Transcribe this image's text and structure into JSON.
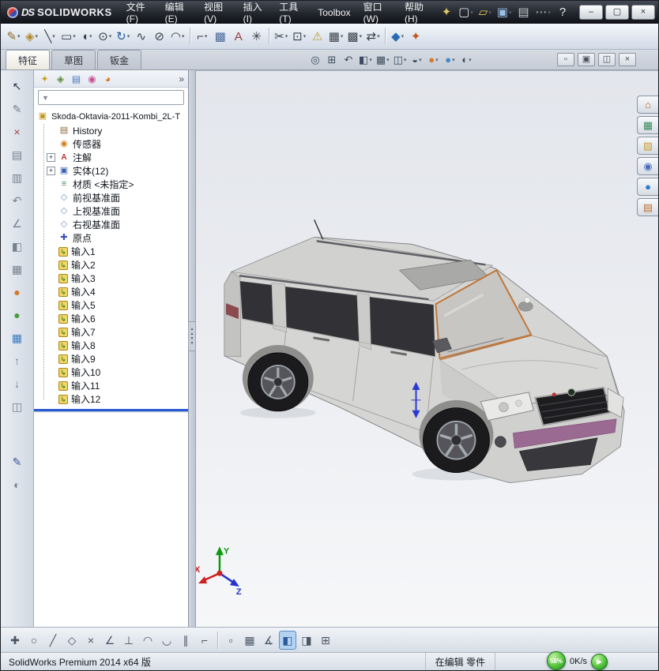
{
  "app": {
    "logo_mark": "DS",
    "logo_text": "SOLIDWORKS",
    "menus": [
      "文件(F)",
      "编辑(E)",
      "视图(V)",
      "插入(I)",
      "工具(T)",
      "Toolbox",
      "窗口(W)",
      "帮助(H)"
    ]
  },
  "tabs": [
    {
      "label": "特征",
      "active": true
    },
    {
      "label": "草图",
      "active": false
    },
    {
      "label": "钣金",
      "active": false
    }
  ],
  "tree_panel": {
    "overflow": "»",
    "filter_glyph": "▼"
  },
  "feature_tree": {
    "root_label": "Skoda-Oktavia-2011-Kombi_2L-T",
    "icon_glyphs": {
      "part": "▣",
      "history": "▤",
      "sensor": "◉",
      "annotation": "A",
      "bodies": "▣",
      "material": "≡",
      "plane": "◇",
      "origin": "✚",
      "imported": "↳"
    },
    "items": [
      {
        "label": "History",
        "icon": "history"
      },
      {
        "label": "传感器",
        "icon": "sensor"
      },
      {
        "label": "注解",
        "icon": "annotation",
        "expander": true
      },
      {
        "label": "实体(12)",
        "icon": "bodies",
        "expander": true
      },
      {
        "label": "材质 <未指定>",
        "icon": "material"
      },
      {
        "label": "前视基准面",
        "icon": "plane"
      },
      {
        "label": "上视基准面",
        "icon": "plane"
      },
      {
        "label": "右视基准面",
        "icon": "plane"
      },
      {
        "label": "原点",
        "icon": "origin"
      },
      {
        "label": "输入1",
        "icon": "imported"
      },
      {
        "label": "输入2",
        "icon": "imported"
      },
      {
        "label": "输入3",
        "icon": "imported"
      },
      {
        "label": "输入4",
        "icon": "imported"
      },
      {
        "label": "输入5",
        "icon": "imported"
      },
      {
        "label": "输入6",
        "icon": "imported"
      },
      {
        "label": "输入7",
        "icon": "imported"
      },
      {
        "label": "输入8",
        "icon": "imported"
      },
      {
        "label": "输入9",
        "icon": "imported"
      },
      {
        "label": "输入10",
        "icon": "imported"
      },
      {
        "label": "输入11",
        "icon": "imported"
      },
      {
        "label": "输入12",
        "icon": "imported"
      }
    ]
  },
  "viewport": {
    "triad": {
      "x": "X",
      "y": "Y",
      "z": "Z"
    }
  },
  "statusbar": {
    "product": "SolidWorks Premium 2014 x64 版",
    "mode": "在编辑 零件",
    "gauge_percent": "58%",
    "net_speed": "0K/s",
    "boost_glyph": "▶"
  },
  "icon_groups": {
    "titlebar_quick": [
      {
        "name": "menu-pin-icon",
        "glyph": "✦",
        "color": "#e0c860"
      },
      {
        "name": "new-document-icon",
        "glyph": "▢",
        "color": "#e6ebf2",
        "caret": true
      },
      {
        "name": "open-document-icon",
        "glyph": "▱",
        "color": "#e8c85a",
        "caret": true
      },
      {
        "name": "save-icon",
        "glyph": "▣",
        "color": "#9ac0e8",
        "caret": true
      },
      {
        "name": "print-icon",
        "glyph": "▤",
        "color": "#c6ccd6"
      },
      {
        "name": "options-icon",
        "glyph": "⋯",
        "color": "#c6ccd6",
        "caret": true
      },
      {
        "name": "help-icon",
        "glyph": "?",
        "color": "#e6ebf2"
      }
    ],
    "window_controls": [
      {
        "name": "minimize-button",
        "glyph": "–"
      },
      {
        "name": "maximize-button",
        "glyph": "▢"
      },
      {
        "name": "close-button",
        "glyph": "×"
      }
    ],
    "toolbar_main": [
      {
        "name": "sketch-icon",
        "glyph": "✎",
        "color": "#8a6a2a",
        "caret": true
      },
      {
        "name": "smart-dimension-icon",
        "glyph": "◈",
        "color": "#b08828",
        "caret": true
      },
      {
        "name": "line-icon",
        "glyph": "╲",
        "color": "#384048",
        "caret": true
      },
      {
        "name": "corner-rectangle-icon",
        "glyph": "▭",
        "color": "#384048",
        "caret": true
      },
      {
        "name": "straight-slot-icon",
        "glyph": "◖",
        "color": "#384048",
        "caret": true
      },
      {
        "name": "circle-icon",
        "glyph": "⊙",
        "color": "#384048",
        "caret": true
      },
      {
        "name": "spiral-icon",
        "glyph": "↻",
        "color": "#2a5a9a",
        "caret": true
      },
      {
        "name": "spline-icon",
        "glyph": "∿",
        "color": "#384048"
      },
      {
        "name": "ellipse-icon",
        "glyph": "⊘",
        "color": "#384048"
      },
      {
        "name": "arc-icon",
        "glyph": "◠",
        "color": "#384048",
        "caret": true
      },
      {
        "sep": true
      },
      {
        "name": "sketch-fillet-icon",
        "glyph": "⌐",
        "color": "#384048",
        "caret": true
      },
      {
        "name": "convert-entities-icon",
        "glyph": "▩",
        "color": "#4a6a9a"
      },
      {
        "name": "text-icon",
        "glyph": "A",
        "color": "#9a3a3a"
      },
      {
        "name": "point-icon",
        "glyph": "✳",
        "color": "#384048"
      },
      {
        "sep": true
      },
      {
        "name": "trim-entities-icon",
        "glyph": "✂",
        "color": "#384048",
        "caret": true
      },
      {
        "name": "offset-entities-icon",
        "glyph": "⊡",
        "color": "#384048",
        "caret": true
      },
      {
        "name": "warning-icon",
        "glyph": "⚠",
        "color": "#c8a020"
      },
      {
        "name": "linear-pattern-icon",
        "glyph": "▦",
        "color": "#384048",
        "caret": true
      },
      {
        "name": "display-grid-icon",
        "glyph": "▩",
        "color": "#384048",
        "caret": true
      },
      {
        "name": "move-entities-icon",
        "glyph": "⇄",
        "color": "#384048",
        "caret": true
      },
      {
        "sep": true
      },
      {
        "name": "quick-snaps-icon",
        "glyph": "◆",
        "color": "#2a6ab0",
        "caret": true
      },
      {
        "name": "rapid-sketch-icon",
        "glyph": "✦",
        "color": "#c05820"
      }
    ],
    "viewport_toolbar": [
      {
        "name": "zoom-to-fit-icon",
        "glyph": "◎",
        "color": "#3a4a5c"
      },
      {
        "name": "zoom-to-area-icon",
        "glyph": "⊞",
        "color": "#3a4a5c"
      },
      {
        "name": "previous-view-icon",
        "glyph": "↶",
        "color": "#3a4a5c"
      },
      {
        "name": "section-view-icon",
        "glyph": "◧",
        "color": "#3a4a5c",
        "caret": true
      },
      {
        "name": "view-orientation-icon",
        "glyph": "▦",
        "color": "#3a4a5c",
        "caret": true
      },
      {
        "name": "display-style-icon",
        "glyph": "◫",
        "color": "#3a4a5c",
        "caret": true
      },
      {
        "name": "hide-show-items-icon",
        "glyph": "◒",
        "color": "#3a4a5c",
        "caret": true
      },
      {
        "name": "edit-app­earance-icon",
        "glyph": "●",
        "color": "#d4782a",
        "caret": true
      },
      {
        "name": "apply-scene-icon",
        "glyph": "●",
        "color": "#3a8ad0",
        "caret": true
      },
      {
        "name": "view-settings-icon",
        "glyph": "◐",
        "color": "#3a4a5c",
        "caret": true
      }
    ],
    "doc_window_buttons": [
      {
        "name": "doc-minimize-icon",
        "glyph": "▫"
      },
      {
        "name": "doc-restore-icon",
        "glyph": "▣"
      },
      {
        "name": "doc-tile-icon",
        "glyph": "◫"
      },
      {
        "name": "doc-close-icon",
        "glyph": "×"
      }
    ],
    "left_strip": [
      {
        "name": "select-cursor-icon",
        "glyph": "↖",
        "color": "#2a3240"
      },
      {
        "name": "sketch-edit-icon",
        "glyph": "✎",
        "color": "#77808e"
      },
      {
        "name": "delete-icon",
        "glyph": "×",
        "color": "#a04848"
      },
      {
        "name": "copy-icon",
        "glyph": "▤",
        "color": "#77808e"
      },
      {
        "name": "paste-icon",
        "glyph": "▥",
        "color": "#77808e"
      },
      {
        "name": "undo-icon",
        "glyph": "↶",
        "color": "#77808e"
      },
      {
        "name": "measure-icon",
        "glyph": "∠",
        "color": "#77808e"
      },
      {
        "name": "section-tool-icon",
        "glyph": "◧",
        "color": "#77808e"
      },
      {
        "name": "view-cube-icon",
        "glyph": "▦",
        "color": "#77808e"
      },
      {
        "name": "appearance-ball-icon",
        "glyph": "●",
        "color": "#d4782a"
      },
      {
        "name": "material-ball-icon",
        "glyph": "●",
        "color": "#4a9a40"
      },
      {
        "name": "texture-grid-icon",
        "glyph": "▦",
        "color": "#3a7ac2"
      },
      {
        "name": "feature-order-up-icon",
        "glyph": "↑",
        "color": "#77808e"
      },
      {
        "name": "feature-order-down-icon",
        "glyph": "↓",
        "color": "#77808e"
      },
      {
        "name": "display-states-icon",
        "glyph": "◫",
        "color": "#77808e"
      },
      {
        "gap": 36
      },
      {
        "name": "paint-tool-icon",
        "glyph": "✎",
        "color": "#3a5a9a"
      },
      {
        "name": "eyedropper-icon",
        "glyph": "◐",
        "color": "#77808e"
      }
    ],
    "tree_toolbar": [
      {
        "name": "featuremanager-tab-icon",
        "glyph": "✦",
        "color": "#c8a020"
      },
      {
        "name": "propertymanager-tab-icon",
        "glyph": "◈",
        "color": "#5a8a3a"
      },
      {
        "name": "configurationmanager-tab-icon",
        "glyph": "▤",
        "color": "#4a7ac0"
      },
      {
        "name": "dimxpertmanager-tab-icon",
        "glyph": "◉",
        "color": "#c8509a"
      },
      {
        "name": "displaymanager-tab-icon",
        "glyph": "◕",
        "color": "#d4782a"
      }
    ],
    "right_taskpane": [
      {
        "name": "task-pane-home-icon",
        "glyph": "⌂",
        "color": "#b06a2a"
      },
      {
        "name": "design-library-icon",
        "glyph": "▦",
        "color": "#3a8a5a"
      },
      {
        "name": "file-explorer-icon",
        "glyph": "▨",
        "color": "#c8a030"
      },
      {
        "name": "appearances-scenes-icon",
        "glyph": "◉",
        "color": "#4a6ac0"
      },
      {
        "name": "solidworks-resources-icon",
        "glyph": "●",
        "color": "#2a7ad0"
      },
      {
        "name": "custom-properties-icon",
        "glyph": "▤",
        "color": "#c07030"
      }
    ],
    "bottom_toolbar": [
      {
        "name": "sketch-origin-snap-icon",
        "glyph": "✚"
      },
      {
        "name": "circle-snap-icon",
        "glyph": "○"
      },
      {
        "name": "line-snap-icon",
        "glyph": "╱"
      },
      {
        "name": "point-snap-icon",
        "glyph": "◇"
      },
      {
        "name": "intersection-snap-icon",
        "glyph": "×"
      },
      {
        "name": "angle-snap-icon",
        "glyph": "∠"
      },
      {
        "name": "perpendicular-snap-icon",
        "glyph": "⊥"
      },
      {
        "name": "arc-snap-icon",
        "glyph": "◠"
      },
      {
        "name": "tangent-snap-icon",
        "glyph": "◡"
      },
      {
        "name": "parallel-snap-icon",
        "glyph": "∥"
      },
      {
        "name": "corner-snap-icon",
        "glyph": "⌐"
      },
      {
        "sep": true
      },
      {
        "name": "select-region-icon",
        "glyph": "▫"
      },
      {
        "name": "grid-snap-icon",
        "glyph": "▦"
      },
      {
        "name": "angle-measure-icon",
        "glyph": "∡"
      },
      {
        "name": "shaded-view-icon",
        "glyph": "◧",
        "color": "#2a5a9a",
        "active": true
      },
      {
        "name": "wireframe-view-icon",
        "glyph": "◨"
      },
      {
        "name": "table-view-icon",
        "glyph": "⊞"
      }
    ]
  }
}
